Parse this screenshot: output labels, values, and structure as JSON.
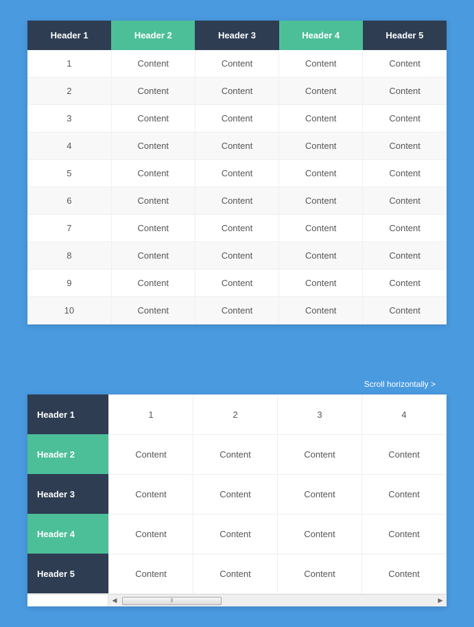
{
  "table1": {
    "headers": [
      {
        "label": "Header 1",
        "style": "dark"
      },
      {
        "label": "Header 2",
        "style": "green"
      },
      {
        "label": "Header 3",
        "style": "dark"
      },
      {
        "label": "Header 4",
        "style": "green"
      },
      {
        "label": "Header 5",
        "style": "dark"
      }
    ],
    "rows": [
      {
        "cells": [
          "1",
          "Content",
          "Content",
          "Content",
          "Content"
        ]
      },
      {
        "cells": [
          "2",
          "Content",
          "Content",
          "Content",
          "Content"
        ]
      },
      {
        "cells": [
          "3",
          "Content",
          "Content",
          "Content",
          "Content"
        ]
      },
      {
        "cells": [
          "4",
          "Content",
          "Content",
          "Content",
          "Content"
        ]
      },
      {
        "cells": [
          "5",
          "Content",
          "Content",
          "Content",
          "Content"
        ]
      },
      {
        "cells": [
          "6",
          "Content",
          "Content",
          "Content",
          "Content"
        ]
      },
      {
        "cells": [
          "7",
          "Content",
          "Content",
          "Content",
          "Content"
        ]
      },
      {
        "cells": [
          "8",
          "Content",
          "Content",
          "Content",
          "Content"
        ]
      },
      {
        "cells": [
          "9",
          "Content",
          "Content",
          "Content",
          "Content"
        ]
      },
      {
        "cells": [
          "10",
          "Content",
          "Content",
          "Content",
          "Content"
        ]
      }
    ]
  },
  "scroll_hint": "Scroll horizontally >",
  "table2": {
    "rowHeaders": [
      {
        "label": "Header 1",
        "style": "dark"
      },
      {
        "label": "Header 2",
        "style": "green"
      },
      {
        "label": "Header 3",
        "style": "dark"
      },
      {
        "label": "Header 4",
        "style": "green"
      },
      {
        "label": "Header 5",
        "style": "dark"
      }
    ],
    "rows": [
      {
        "cells": [
          "1",
          "2",
          "3",
          "4"
        ]
      },
      {
        "cells": [
          "Content",
          "Content",
          "Content",
          "Content"
        ]
      },
      {
        "cells": [
          "Content",
          "Content",
          "Content",
          "Content"
        ]
      },
      {
        "cells": [
          "Content",
          "Content",
          "Content",
          "Content"
        ]
      },
      {
        "cells": [
          "Content",
          "Content",
          "Content",
          "Content"
        ]
      }
    ]
  },
  "scrollbar": {
    "thumb_glyph": "⫴",
    "left_arrow": "◀",
    "right_arrow": "▶"
  }
}
